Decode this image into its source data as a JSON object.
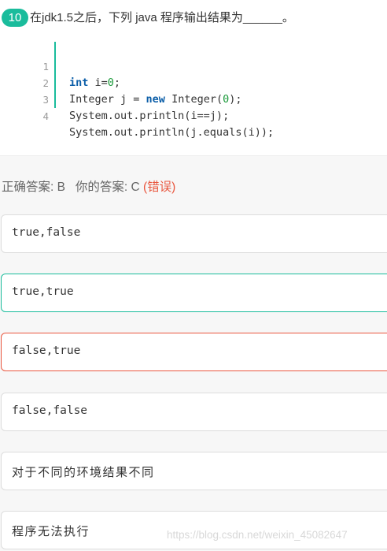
{
  "question": {
    "number": "10",
    "text": "在jdk1.5之后，下列 java 程序输出结果为______。"
  },
  "code": {
    "lines": [
      {
        "num": "1",
        "tokens": [
          {
            "t": "int",
            "cls": "kw"
          },
          {
            "t": " i="
          },
          {
            "t": "0",
            "cls": "num"
          },
          {
            "t": ";"
          }
        ]
      },
      {
        "num": "2",
        "tokens": [
          {
            "t": "Integer j = "
          },
          {
            "t": "new",
            "cls": "kw"
          },
          {
            "t": " Integer("
          },
          {
            "t": "0",
            "cls": "num"
          },
          {
            "t": ");"
          }
        ]
      },
      {
        "num": "3",
        "tokens": [
          {
            "t": "System.out.println(i==j);"
          }
        ]
      },
      {
        "num": "4",
        "tokens": [
          {
            "t": "System.out.println(j.equals(i));"
          }
        ]
      }
    ]
  },
  "answer": {
    "correct_prefix": "正确答案: B",
    "yours_prefix": "你的答案: C",
    "status": "(错误)"
  },
  "options": [
    {
      "label": "true,false",
      "state": "normal",
      "cn": false
    },
    {
      "label": "true,true",
      "state": "correct",
      "cn": false
    },
    {
      "label": "false,true",
      "state": "incorrect",
      "cn": false
    },
    {
      "label": "false,false",
      "state": "normal",
      "cn": false
    },
    {
      "label": "对于不同的环境结果不同",
      "state": "normal",
      "cn": true
    },
    {
      "label": "程序无法执行",
      "state": "normal",
      "cn": true
    }
  ],
  "watermark": "https://blog.csdn.net/weixin_45082647",
  "colors": {
    "accent": "#1abc9c",
    "error": "#e9573f",
    "keyword": "#0b5ea8",
    "number": "#1a9a3a"
  }
}
